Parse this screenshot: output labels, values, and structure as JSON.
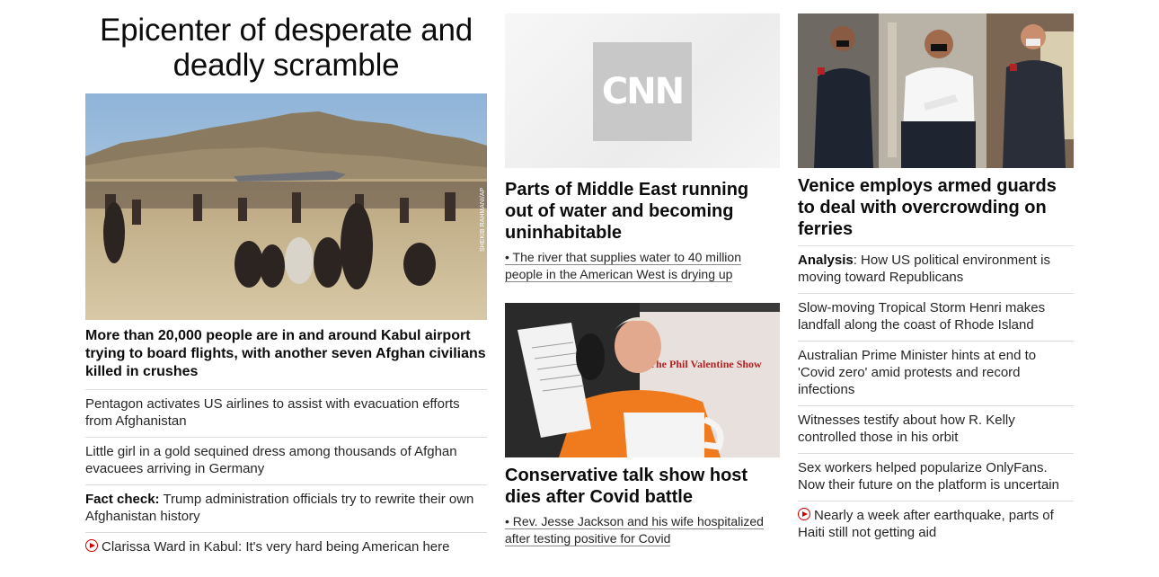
{
  "col1": {
    "headline": "Epicenter of desperate and deadly scramble",
    "photo_credit": "SHEKIB RAHMANI/AP",
    "lead": "More than 20,000 people are in and around Kabul airport trying to board flights, with another seven Afghan civilians killed in crushes",
    "items": [
      {
        "prefix": "",
        "text": "Pentagon activates US airlines to assist with evacuation efforts from Afghanistan",
        "video": false
      },
      {
        "prefix": "",
        "text": "Little girl in a gold sequined dress among thousands of Afghan evacuees arriving in Germany",
        "video": false
      },
      {
        "prefix": "Fact check:",
        "text": " Trump administration officials try to rewrite their own Afghanistan history",
        "video": false
      },
      {
        "prefix": "",
        "text": "Clarissa Ward in Kabul: It's very hard being American here",
        "video": true
      }
    ]
  },
  "col2": {
    "logo_text": "CNN",
    "story1_title": "Parts of Middle East running out of water and becoming uninhabitable",
    "story1_sub": "• The river that supplies water to 40 million people in the American West is drying up",
    "show_sign": "The Phil Valentine Show",
    "story2_title": "Conservative talk show host dies after Covid battle",
    "story2_sub": "• Rev. Jesse Jackson and his wife hospitalized after testing positive for Covid"
  },
  "col3": {
    "story_title": "Venice employs armed guards to deal with overcrowding on ferries",
    "items": [
      {
        "prefix": "Analysis",
        "text": ": How US political environment is moving toward Republicans",
        "video": false
      },
      {
        "prefix": "",
        "text": "Slow-moving Tropical Storm Henri makes landfall along the coast of Rhode Island",
        "video": false
      },
      {
        "prefix": "",
        "text": "Australian Prime Minister hints at end to 'Covid zero' amid protests and record infections",
        "video": false
      },
      {
        "prefix": "",
        "text": "Witnesses testify about how R. Kelly controlled those in his orbit",
        "video": false
      },
      {
        "prefix": "",
        "text": "Sex workers helped popularize OnlyFans. Now their future on the platform is uncertain",
        "video": false
      },
      {
        "prefix": "",
        "text": "Nearly a week after earthquake, parts of Haiti still not getting aid",
        "video": true
      }
    ]
  },
  "colors": {
    "accent": "#cc0000",
    "text": "#262626",
    "divider": "#dcdcdc"
  }
}
